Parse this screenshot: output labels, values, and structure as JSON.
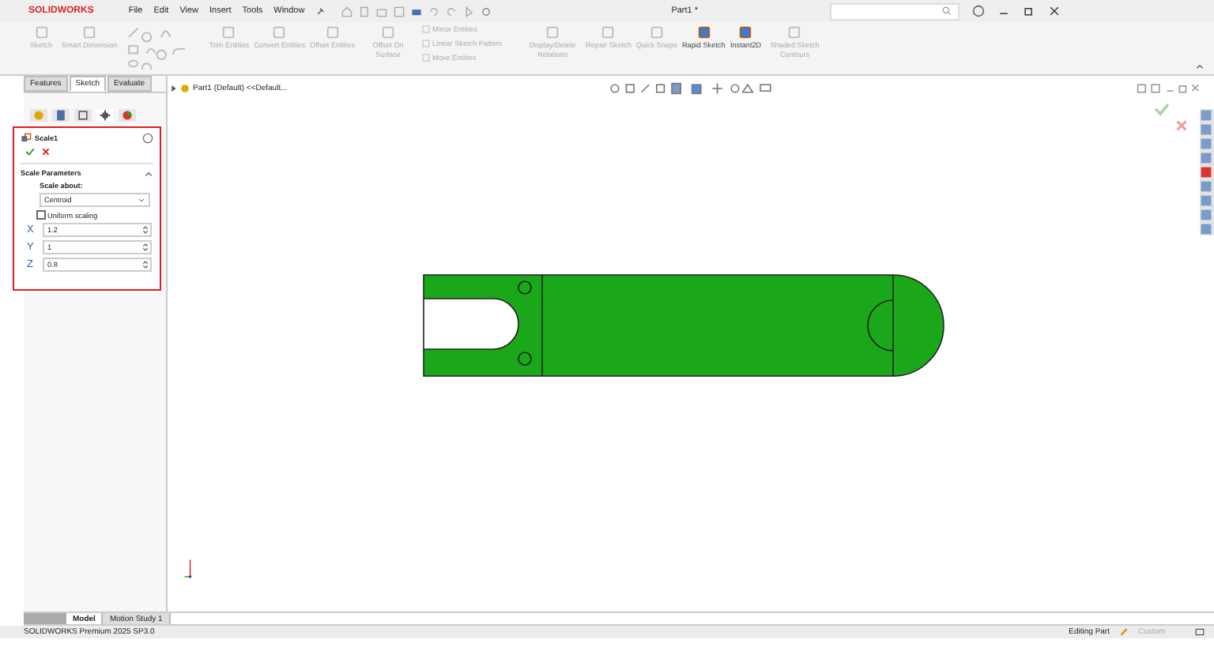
{
  "app": {
    "logo": "SOLIDWORKS",
    "menu": [
      "File",
      "Edit",
      "View",
      "Insert",
      "Tools",
      "Window"
    ],
    "title": "Part1 *"
  },
  "ribbon": [
    {
      "kind": "large",
      "label": "Sketch",
      "disabled": true
    },
    {
      "kind": "large",
      "label": "Smart Dimension",
      "disabled": true
    },
    {
      "kind": "icons"
    },
    {
      "kind": "large",
      "label": "Trim Entities",
      "disabled": true
    },
    {
      "kind": "large",
      "label": "Convert Entities",
      "disabled": true
    },
    {
      "kind": "large",
      "label": "Offset Entities",
      "disabled": true
    },
    {
      "kind": "large",
      "label": "Offset On Surface",
      "disabled": true
    },
    {
      "kind": "stack",
      "items": [
        "Mirror Entities",
        "Linear Sketch Pattern",
        "Move Entities"
      ],
      "disabled": true
    },
    {
      "kind": "large",
      "label": "Display/Delete Relations",
      "disabled": true
    },
    {
      "kind": "large",
      "label": "Repair Sketch",
      "disabled": true
    },
    {
      "kind": "large",
      "label": "Quick Snaps",
      "disabled": true
    },
    {
      "kind": "large",
      "label": "Rapid Sketch",
      "disabled": false
    },
    {
      "kind": "large",
      "label": "Instant2D",
      "disabled": false
    },
    {
      "kind": "large",
      "label": "Shaded Sketch Contours",
      "disabled": true
    }
  ],
  "tabs": [
    {
      "label": "Features",
      "selected": false
    },
    {
      "label": "Sketch",
      "selected": true
    },
    {
      "label": "Evaluate",
      "selected": false
    }
  ],
  "property_manager": {
    "title": "Scale1",
    "section": "Scale Parameters",
    "scale_about_label": "Scale about:",
    "scale_about": "Centroid",
    "uniform_scaling": {
      "label": "Uniform scaling",
      "checked": false
    },
    "fields": [
      {
        "axis": "X",
        "value": "1.2",
        "color": "#2f5fa8"
      },
      {
        "axis": "Y",
        "value": "1",
        "color": "#2f5fa8"
      },
      {
        "axis": "Z",
        "value": "0.8",
        "color": "#2f5fa8"
      }
    ]
  },
  "tree": {
    "label": "Part1 (Default) <<Default..."
  },
  "bottom_tabs": [
    {
      "label": "Model",
      "selected": true
    },
    {
      "label": "Motion Study 1",
      "selected": false
    }
  ],
  "status_bar": {
    "product": "SOLIDWORKS Premium 2025 SP3.0",
    "mode": "Editing Part",
    "units": "Custom"
  }
}
